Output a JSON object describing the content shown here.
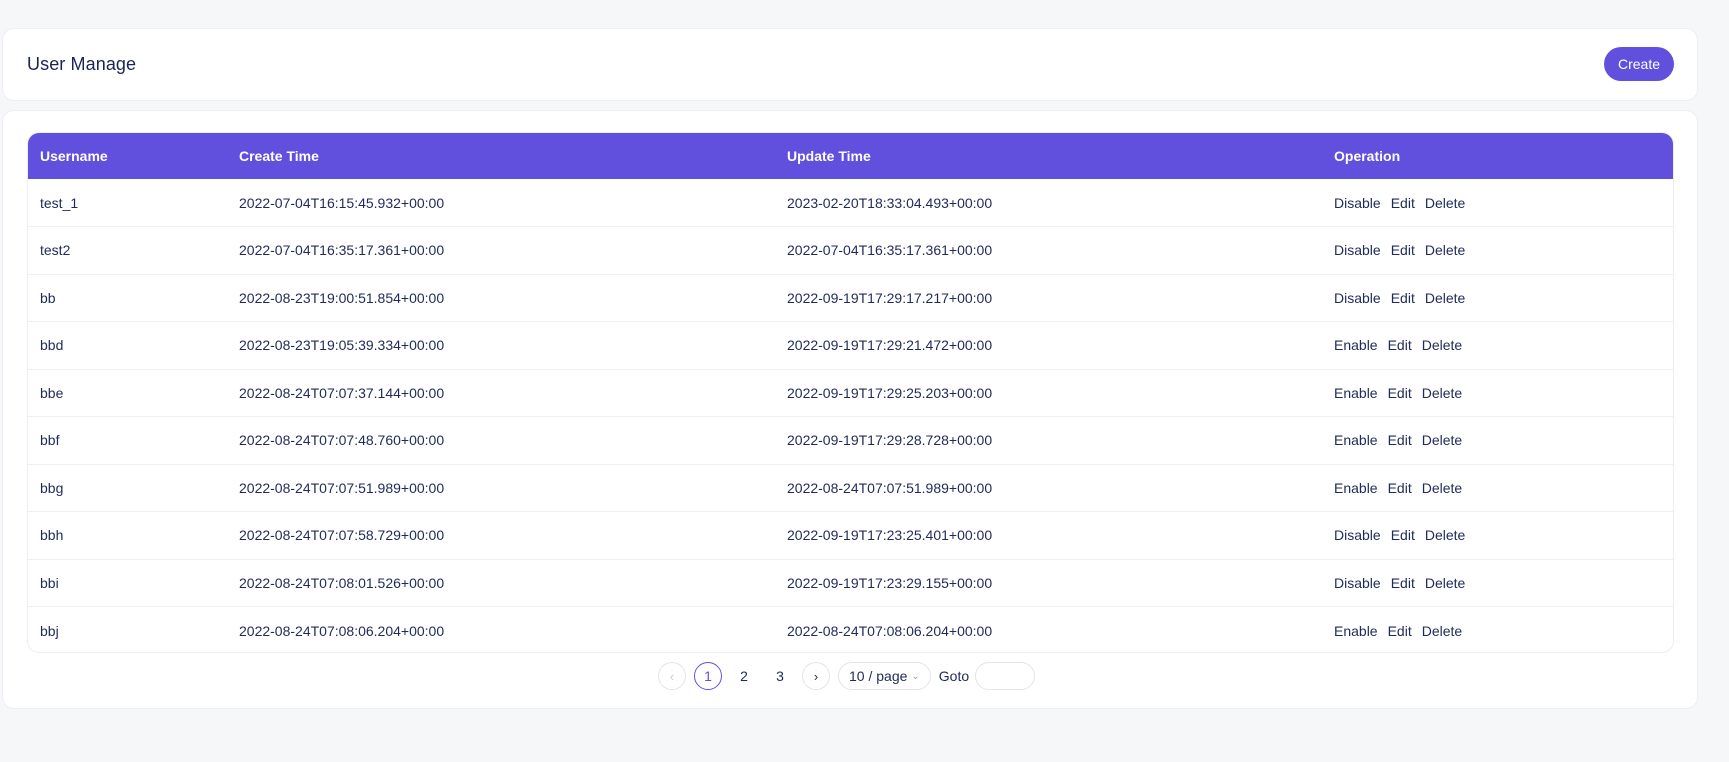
{
  "header": {
    "title": "User Manage",
    "create_label": "Create"
  },
  "table": {
    "columns": [
      "Username",
      "Create Time",
      "Update Time",
      "Operation"
    ],
    "rows": [
      {
        "username": "test_1",
        "create_time": "2022-07-04T16:15:45.932+00:00",
        "update_time": "2023-02-20T18:33:04.493+00:00",
        "toggle": "Disable"
      },
      {
        "username": "test2",
        "create_time": "2022-07-04T16:35:17.361+00:00",
        "update_time": "2022-07-04T16:35:17.361+00:00",
        "toggle": "Disable"
      },
      {
        "username": "bb",
        "create_time": "2022-08-23T19:00:51.854+00:00",
        "update_time": "2022-09-19T17:29:17.217+00:00",
        "toggle": "Disable"
      },
      {
        "username": "bbd",
        "create_time": "2022-08-23T19:05:39.334+00:00",
        "update_time": "2022-09-19T17:29:21.472+00:00",
        "toggle": "Enable"
      },
      {
        "username": "bbe",
        "create_time": "2022-08-24T07:07:37.144+00:00",
        "update_time": "2022-09-19T17:29:25.203+00:00",
        "toggle": "Enable"
      },
      {
        "username": "bbf",
        "create_time": "2022-08-24T07:07:48.760+00:00",
        "update_time": "2022-09-19T17:29:28.728+00:00",
        "toggle": "Enable"
      },
      {
        "username": "bbg",
        "create_time": "2022-08-24T07:07:51.989+00:00",
        "update_time": "2022-08-24T07:07:51.989+00:00",
        "toggle": "Enable"
      },
      {
        "username": "bbh",
        "create_time": "2022-08-24T07:07:58.729+00:00",
        "update_time": "2022-09-19T17:23:25.401+00:00",
        "toggle": "Disable"
      },
      {
        "username": "bbi",
        "create_time": "2022-08-24T07:08:01.526+00:00",
        "update_time": "2022-09-19T17:23:29.155+00:00",
        "toggle": "Disable"
      },
      {
        "username": "bbj",
        "create_time": "2022-08-24T07:08:06.204+00:00",
        "update_time": "2022-08-24T07:08:06.204+00:00",
        "toggle": "Enable"
      }
    ],
    "edit_label": "Edit",
    "delete_label": "Delete"
  },
  "pagination": {
    "prev_icon": "chevron-left-icon",
    "next_icon": "chevron-right-icon",
    "pages": [
      "1",
      "2",
      "3"
    ],
    "current_page": "1",
    "page_size_label": "10 / page",
    "goto_label": "Goto",
    "goto_value": ""
  },
  "colors": {
    "accent": "#6150de",
    "background": "#f6f7f9",
    "text": "#1f2a5a"
  }
}
